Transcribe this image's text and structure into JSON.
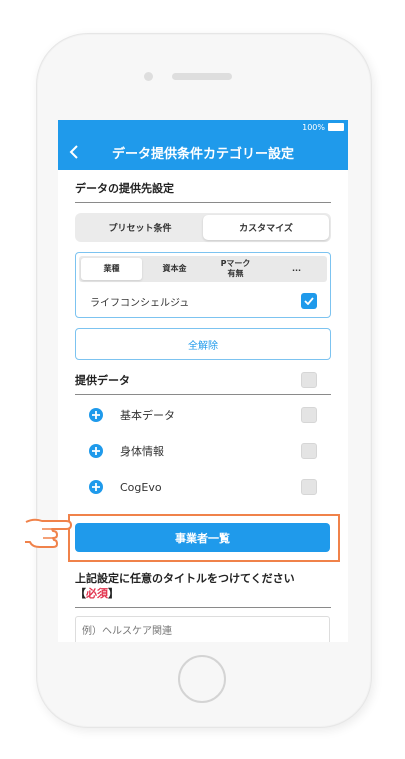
{
  "status_bar": {
    "battery": "100%"
  },
  "header": {
    "title": "データ提供条件カテゴリー設定"
  },
  "provider_section": {
    "title": "データの提供先設定"
  },
  "segmented": {
    "preset": "プリセット条件",
    "custom": "カスタマイズ",
    "selected": "custom"
  },
  "categories": {
    "tabs": [
      {
        "label": "業種",
        "active": true
      },
      {
        "label": "資本金",
        "active": false
      },
      {
        "label": "Pマーク\n有無",
        "active": false
      },
      {
        "label": "...",
        "active": false
      }
    ],
    "item": {
      "label": "ライフコンシェルジュ",
      "checked": true
    }
  },
  "clear_all": "全解除",
  "data_section": {
    "title": "提供データ",
    "items": [
      {
        "label": "基本データ",
        "checked": false
      },
      {
        "label": "身体情報",
        "checked": false
      },
      {
        "label": "CogEvo",
        "checked": false
      }
    ]
  },
  "list_button": "事業者一覧",
  "title_field": {
    "label": "上記設定に任意のタイトルをつけてください",
    "required_open": "【",
    "required": "必須",
    "required_close": "】",
    "placeholder": "例）ヘルスケア関連"
  },
  "colors": {
    "primary": "#1f9aeb",
    "highlight": "#f0824a",
    "required": "#e2324d"
  }
}
